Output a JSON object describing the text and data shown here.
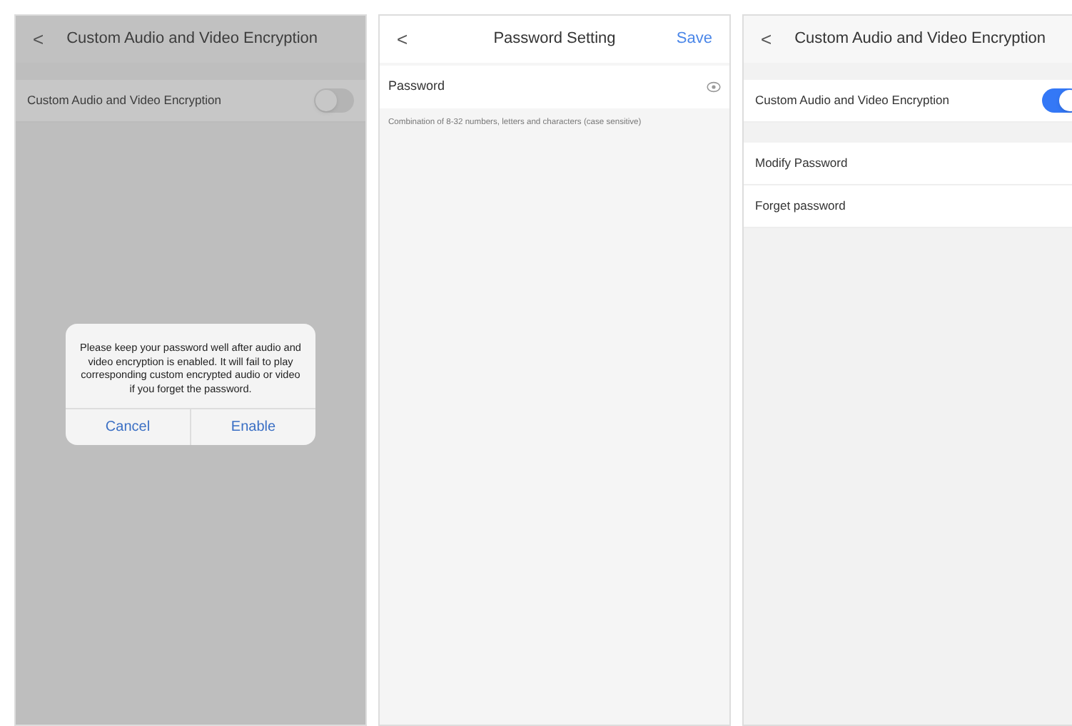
{
  "screens": [
    {
      "kind": "settings",
      "back": "<",
      "title": "Custom Audio and Video Encryption",
      "dimmed": true,
      "rows": [
        {
          "kind": "toggle",
          "label": "Custom Audio and Video Encryption",
          "on": false
        }
      ],
      "dialog": {
        "message": "Please keep your password well after audio and video encryption is enabled. It will fail to play corresponding custom encrypted audio or video if you forget the password.",
        "buttons": [
          "Cancel",
          "Enable"
        ]
      }
    },
    {
      "kind": "password",
      "back": "<",
      "title": "Password Setting",
      "action": "Save",
      "field": {
        "label": "Password"
      },
      "hint": "Combination of 8-32 numbers, letters and characters (case sensitive)"
    },
    {
      "kind": "settings",
      "back": "<",
      "title": "Custom Audio and Video Encryption",
      "dimmed": false,
      "rows": [
        {
          "kind": "toggle",
          "label": "Custom Audio and Video Encryption",
          "on": true
        },
        {
          "kind": "link",
          "label": "Modify Password"
        },
        {
          "kind": "link",
          "label": "Forget password"
        }
      ]
    }
  ]
}
